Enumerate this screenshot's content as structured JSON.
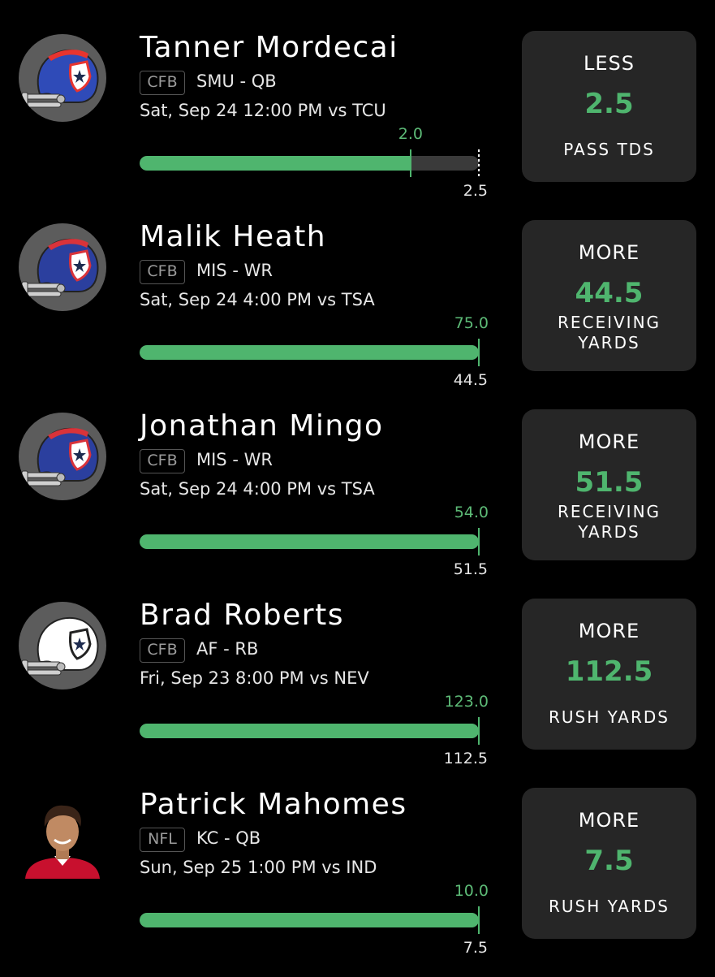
{
  "picks": [
    {
      "name": "Tanner Mordecai",
      "league": "CFB",
      "team_pos": "SMU - QB",
      "game": "Sat, Sep 24 12:00 PM  vs TCU",
      "actual": "2.0",
      "line": "2.5",
      "progress_fraction": 0.8,
      "direction": "LESS",
      "stat_line1": "PASS TDS",
      "stat_line2": "",
      "avatar": "helmet-icon",
      "helmet_color": "#2f4bb8",
      "stripe_color": "#e8342f"
    },
    {
      "name": "Malik Heath",
      "league": "CFB",
      "team_pos": "MIS - WR",
      "game": "Sat, Sep 24 4:00 PM  vs TSA",
      "actual": "75.0",
      "line": "44.5",
      "progress_fraction": 1.0,
      "direction": "MORE",
      "stat_line1": "RECEIVING",
      "stat_line2": "YARDS",
      "avatar": "helmet-icon",
      "helmet_color": "#2b3f9e",
      "stripe_color": "#d9333a"
    },
    {
      "name": "Jonathan Mingo",
      "league": "CFB",
      "team_pos": "MIS - WR",
      "game": "Sat, Sep 24 4:00 PM  vs TSA",
      "actual": "54.0",
      "line": "51.5",
      "progress_fraction": 1.0,
      "direction": "MORE",
      "stat_line1": "RECEIVING",
      "stat_line2": "YARDS",
      "avatar": "helmet-icon",
      "helmet_color": "#2b3f9e",
      "stripe_color": "#d9333a"
    },
    {
      "name": "Brad Roberts",
      "league": "CFB",
      "team_pos": "AF - RB",
      "game": "Fri, Sep 23 8:00 PM  vs NEV",
      "actual": "123.0",
      "line": "112.5",
      "progress_fraction": 1.0,
      "direction": "MORE",
      "stat_line1": "RUSH YARDS",
      "stat_line2": "",
      "avatar": "helmet-icon",
      "helmet_color": "#ffffff",
      "stripe_color": "#ffffff"
    },
    {
      "name": "Patrick Mahomes",
      "league": "NFL",
      "team_pos": "KC - QB",
      "game": "Sun, Sep 25 1:00 PM  vs IND",
      "actual": "10.0",
      "line": "7.5",
      "progress_fraction": 1.0,
      "direction": "MORE",
      "stat_line1": "RUSH YARDS",
      "stat_line2": "",
      "avatar": "player-photo",
      "helmet_color": "#c8102e",
      "stripe_color": "#c8102e"
    }
  ],
  "colors": {
    "accent_green": "#4fb56e",
    "card_bg": "#262626",
    "background": "#000000"
  }
}
